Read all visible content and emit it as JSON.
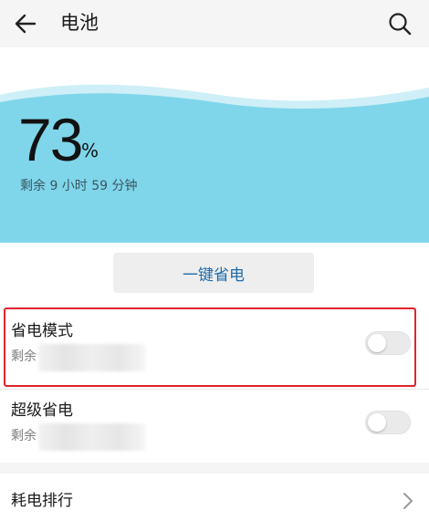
{
  "header": {
    "title": "电池",
    "back_icon": "arrow-left-icon",
    "search_icon": "search-icon"
  },
  "battery": {
    "percent": "73",
    "percent_unit": "%",
    "remaining": "剩余 9 小时 59 分钟",
    "level": 0.73,
    "wave_color": "#7fd6ea"
  },
  "actions": {
    "one_key_save": "一键省电"
  },
  "power_saving_mode": {
    "title": "省电模式",
    "subtitle": "剩余",
    "enabled": false
  },
  "super_power_saving": {
    "title": "超级省电",
    "subtitle": "剩余",
    "enabled": false
  },
  "consumption_ranking": {
    "title": "耗电排行"
  },
  "colors": {
    "accent_text": "#1f6aa8",
    "highlight": "#e0242a"
  }
}
